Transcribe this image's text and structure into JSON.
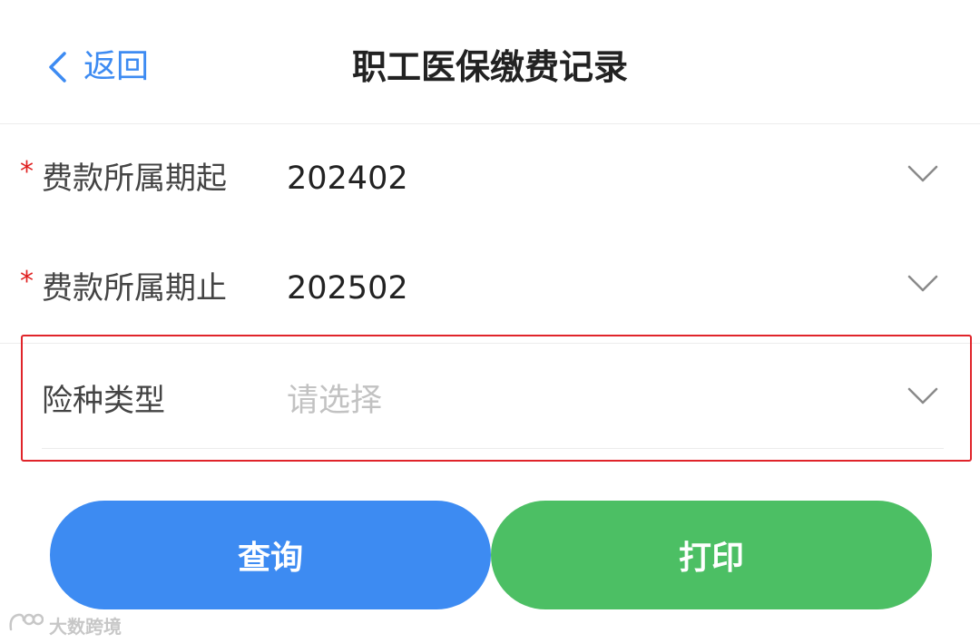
{
  "header": {
    "back_label": "返回",
    "title": "职工医保缴费记录"
  },
  "form": {
    "period_start": {
      "required_mark": "*",
      "label": "费款所属期起",
      "value": "202402"
    },
    "period_end": {
      "required_mark": "*",
      "label": "费款所属期止",
      "value": "202502"
    },
    "insurance_type": {
      "label": "险种类型",
      "placeholder": "请选择"
    }
  },
  "buttons": {
    "query_label": "查询",
    "print_label": "打印"
  },
  "watermark": {
    "text": "大数跨境"
  },
  "colors": {
    "accent_blue": "#3d8bf2",
    "accent_green": "#4cbf64",
    "required_red": "#e02020",
    "highlight_red": "#e0242a"
  },
  "icons": {
    "back": "chevron-left-icon",
    "dropdown": "chevron-down-icon",
    "watermark_logo": "watermark-logo-icon"
  }
}
